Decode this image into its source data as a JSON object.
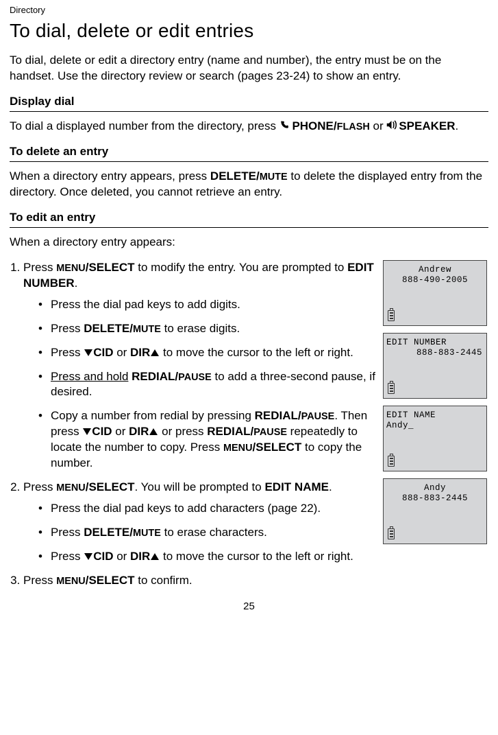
{
  "section_label": "Directory",
  "title": "To dial, delete or edit entries",
  "intro": "To dial, delete or edit a directory entry (name and number), the entry must be on the handset. Use the directory review or search (pages 23-24) to show an entry.",
  "sub1": "Display dial",
  "p1_a": "To dial a displayed number from the directory, press ",
  "p1_phone": "PHONE/",
  "p1_flash": "FLASH",
  "p1_or": " or ",
  "p1_speaker": "SPEAKER",
  "p1_end": ".",
  "sub2": "To delete an entry",
  "p2_a": "When a directory entry appears, press ",
  "p2_del": "DELETE/",
  "p2_mute": "MUTE",
  "p2_b": " to delete the displayed entry from the directory. Once deleted, you cannot retrieve an entry.",
  "sub3": "To edit an entry",
  "p3": "When a directory entry appears:",
  "step1_a": "Press ",
  "step1_menu": "MENU",
  "step1_sep": "/",
  "step1_select": "SELECT",
  "step1_b": " to modify the entry. You are prompted to ",
  "step1_edit": "EDIT NUMBER",
  "step1_c": ".",
  "s1b1": "Press the dial pad keys to add digits.",
  "s1b2_a": "Press ",
  "s1b2_del": "DELETE/",
  "s1b2_mute": "MUTE",
  "s1b2_b": " to erase digits.",
  "s1b3_a": "Press ",
  "s1b3_cid": "CID",
  "s1b3_or": " or ",
  "s1b3_dir": "DIR",
  "s1b3_b": " to move the cursor to the left or right.",
  "s1b4_ph": "Press and hold",
  "s1b4_sp": " ",
  "s1b4_redial": "REDIAL/",
  "s1b4_pause": "PAUSE",
  "s1b4_b": " to add a three-second pause, if desired.",
  "s1b5_a": "Copy a number from redial by pressing ",
  "s1b5_redial": "REDIAL/",
  "s1b5_pause": "PAUSE",
  "s1b5_b": ". Then press ",
  "s1b5_cid": "CID",
  "s1b5_or": " or ",
  "s1b5_dir": "DIR",
  "s1b5_c": " or press ",
  "s1b5_redial2": "REDIAL/",
  "s1b5_pause2": "PAUSE",
  "s1b5_d": " repeatedly to locate the number to copy. Press ",
  "s1b5_menu": "MENU",
  "s1b5_select": "SELECT",
  "s1b5_e": " to copy the number.",
  "step2_a": "Press ",
  "step2_menu": "MENU",
  "step2_select": "SELECT",
  "step2_b": ". You will be prompted to ",
  "step2_editname": "EDIT NAME",
  "step2_c": ".",
  "s2b1": "Press the dial pad keys to add characters (page 22).",
  "s2b2_a": "Press ",
  "s2b2_del": "DELETE/",
  "s2b2_mute": "MUTE",
  "s2b2_b": " to erase characters.",
  "s2b3_a": "Press ",
  "s2b3_cid": "CID",
  "s2b3_or": " or ",
  "s2b3_dir": "DIR",
  "s2b3_b": " to move the cursor to the left or right.",
  "step3_a": "Press ",
  "step3_menu": "MENU",
  "step3_select": "SELECT",
  "step3_b": " to confirm.",
  "screen1_l1": "Andrew",
  "screen1_l2": "888-490-2005",
  "screen2_l1": "EDIT NUMBER",
  "screen2_l2": "888-883-2445",
  "screen3_l1": "EDIT NAME",
  "screen3_l2": "Andy_",
  "screen4_l1": "Andy",
  "screen4_l2": "888-883-2445",
  "page": "25"
}
